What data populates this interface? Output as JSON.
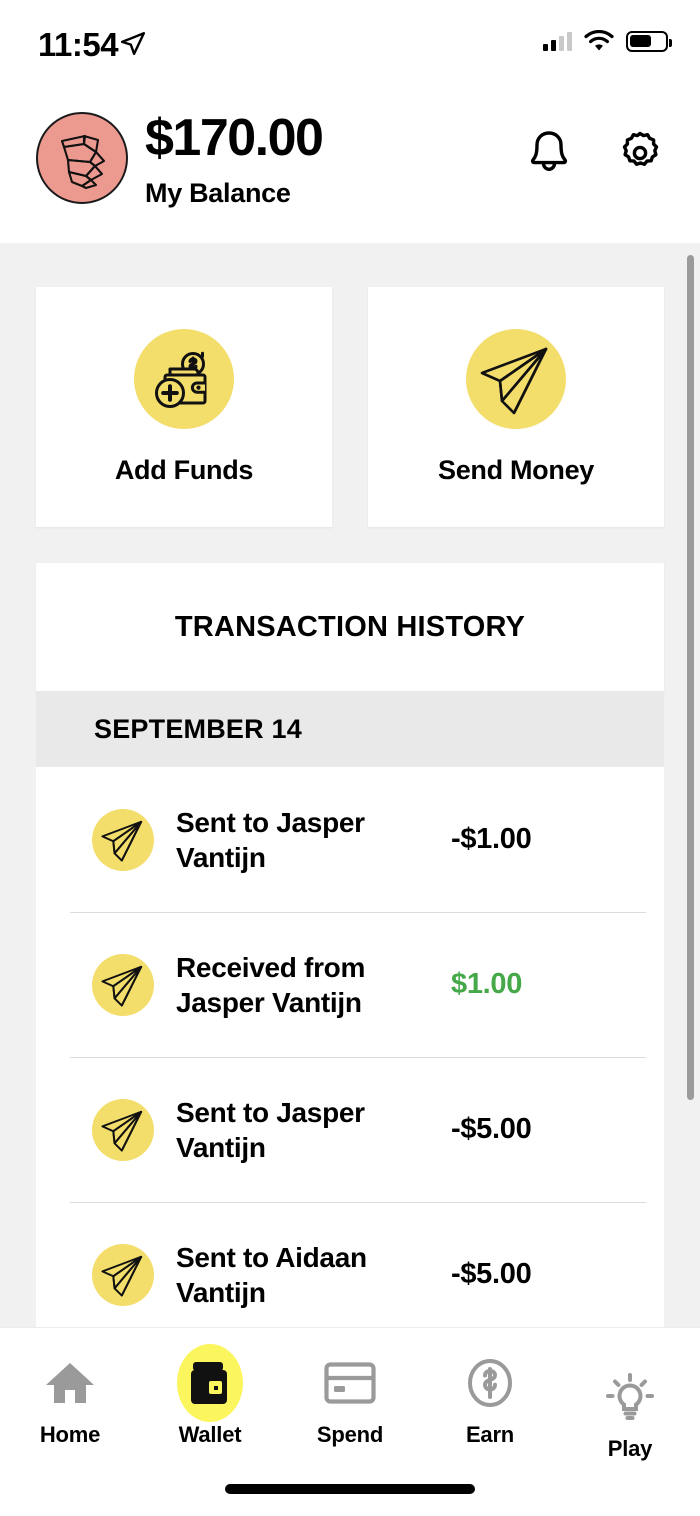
{
  "status_bar": {
    "time": "11:54",
    "location_icon": "location-arrow-icon",
    "signal_icon": "cellular-signal-icon",
    "wifi_icon": "wifi-icon",
    "battery_icon": "battery-icon",
    "battery_level_percent": 55
  },
  "header": {
    "avatar_icon": "origami-toucan-avatar",
    "avatar_bg_color": "#EC9A90",
    "balance_amount": "$170.00",
    "balance_label": "My Balance",
    "notification_icon": "bell-icon",
    "settings_icon": "gear-icon"
  },
  "actions": [
    {
      "label": "Add Funds",
      "icon": "wallet-add-icon"
    },
    {
      "label": "Send Money",
      "icon": "paper-plane-icon"
    }
  ],
  "transactions": {
    "title": "TRANSACTION HISTORY",
    "date_group": "SEPTEMBER 14",
    "rows": [
      {
        "name": "Sent to Jasper Vantijn",
        "amount": "-$1.00",
        "direction": "sent",
        "icon": "paper-plane-icon"
      },
      {
        "name": "Received from Jasper Vantijn",
        "amount": "$1.00",
        "direction": "received",
        "icon": "paper-plane-icon"
      },
      {
        "name": "Sent to Jasper Vantijn",
        "amount": "-$5.00",
        "direction": "sent",
        "icon": "paper-plane-icon"
      },
      {
        "name": "Sent to Aidaan Vantijn",
        "amount": "-$5.00",
        "direction": "sent",
        "icon": "paper-plane-icon"
      }
    ]
  },
  "bottom_nav": {
    "active": "Wallet",
    "items": [
      {
        "label": "Home",
        "icon": "home-icon"
      },
      {
        "label": "Wallet",
        "icon": "wallet-icon"
      },
      {
        "label": "Spend",
        "icon": "credit-card-icon"
      },
      {
        "label": "Earn",
        "icon": "dollar-coin-icon"
      },
      {
        "label": "Play",
        "icon": "lightbulb-icon"
      }
    ]
  },
  "colors": {
    "accent_yellow": "#F3DD6B",
    "active_yellow": "#FBF55E",
    "positive_green": "#45A849",
    "avatar_pink": "#EC9A90",
    "content_bg": "#F1F1F1",
    "date_bar_bg": "#E9E9E9"
  }
}
